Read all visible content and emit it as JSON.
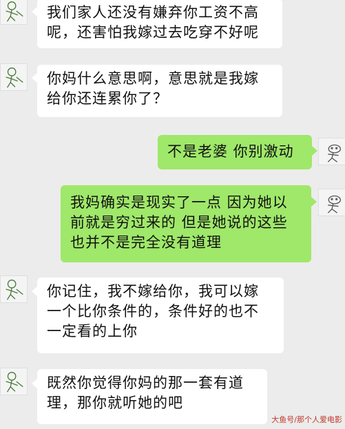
{
  "colors": {
    "background": "#ececec",
    "incoming_bubble": "#ffffff",
    "outgoing_bubble": "#9fe86a"
  },
  "messages": [
    {
      "side": "left",
      "avatar_icon": "doodle-avatar-icon",
      "lines": [
        "我们家人还没有嫌弃你工资不高",
        "呢，还害怕我嫁过去吃穿不好呢"
      ]
    },
    {
      "side": "left",
      "avatar_icon": "doodle-avatar-icon",
      "lines": [
        "你妈什么意思啊，意思就是我嫁",
        "给你还连累你了？"
      ]
    },
    {
      "side": "right",
      "avatar_icon": "doodle-avatar-icon",
      "lines": [
        "不是老婆 你别激动"
      ]
    },
    {
      "side": "right",
      "avatar_icon": "doodle-avatar-icon",
      "lines": [
        "我妈确实是现实了一点 因为她以",
        "前就是穷过来的 但是她说的这些",
        "也并不是完全没有道理"
      ]
    },
    {
      "side": "left",
      "avatar_icon": "doodle-avatar-icon",
      "lines": [
        "你记住，我不嫁给你，我可以嫁",
        "一个比你条件的，条件好的也不",
        "一定看的上你"
      ]
    },
    {
      "side": "left",
      "avatar_icon": "doodle-avatar-icon",
      "lines": [
        "既然你觉得你妈的那一套有道",
        "理，那你就听她的吧"
      ]
    }
  ],
  "watermark": "大鱼号/那个人爱电影"
}
